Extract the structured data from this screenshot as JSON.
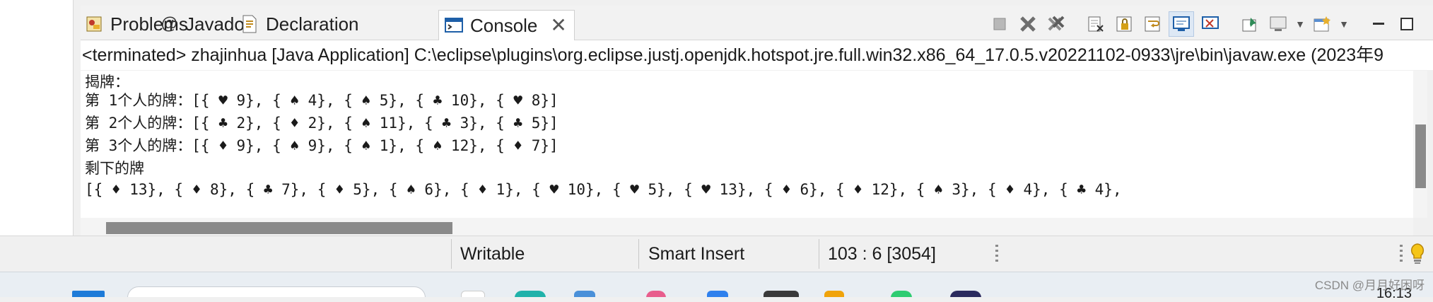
{
  "tabs": [
    {
      "label": "Problems",
      "icon": "problems-icon"
    },
    {
      "label": "Javadoc",
      "icon": "at-icon"
    },
    {
      "label": "Declaration",
      "icon": "declaration-icon"
    },
    {
      "label": "Console",
      "icon": "console-icon",
      "active": true
    }
  ],
  "console": {
    "description": "<terminated> zhajinhua [Java Application] C:\\eclipse\\plugins\\org.eclipse.justj.openjdk.hotspot.jre.full.win32.x86_64_17.0.5.v20221102-0933\\jre\\bin\\javaw.exe  (2023年9",
    "lines": [
      "揭牌：",
      "第 1个人的牌：[{ ♥ 9}, { ♠ 4}, { ♠ 5}, { ♣ 10}, { ♥ 8}]",
      "第 2个人的牌：[{ ♣ 2}, { ♦ 2}, { ♠ 11}, { ♣ 3}, { ♣ 5}]",
      "第 3个人的牌：[{ ♦ 9}, { ♠ 9}, { ♠ 1}, { ♠ 12}, { ♦ 7}]",
      "剩下的牌",
      "[{ ♦ 13}, { ♦ 8}, { ♣ 7}, { ♦ 5}, { ♠ 6}, { ♦ 1}, { ♥ 10}, { ♥ 5}, { ♥ 13}, { ♦ 6}, { ♦ 12}, { ♠ 3}, { ♦ 4}, { ♣ 4},"
    ]
  },
  "status": {
    "writable": "Writable",
    "insert_mode": "Smart Insert",
    "position": "103 : 6 [3054]"
  },
  "taskbar": {
    "clock": "16:13"
  },
  "watermark": "CSDN @月月好困呀",
  "colors": {
    "accent": "#1e5fa8",
    "scroll_thumb": "#8a8a8a"
  }
}
